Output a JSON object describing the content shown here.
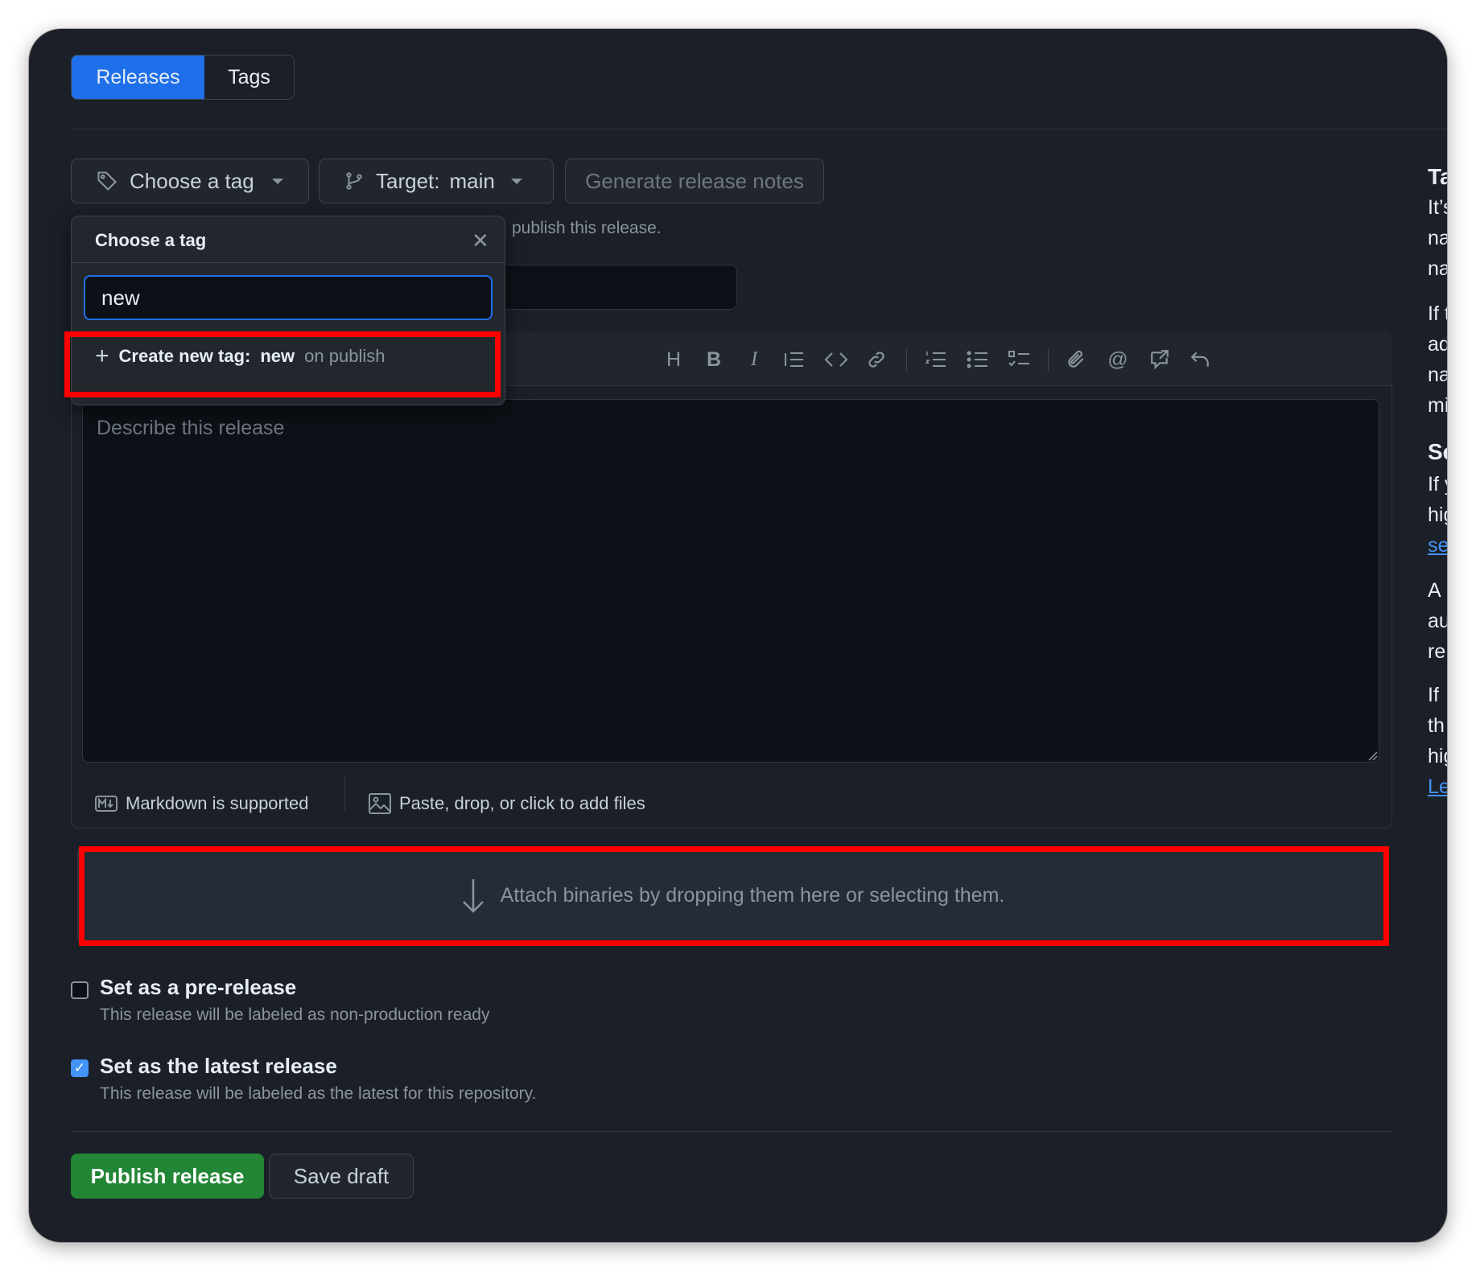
{
  "tabs": {
    "releases": "Releases",
    "tags": "Tags"
  },
  "tag_button": {
    "label": "Choose a tag"
  },
  "target_button": {
    "prefix": "Target:",
    "branch": "main"
  },
  "generate_notes": {
    "label": "Generate release notes"
  },
  "tag_hint": "publish this release.",
  "editor": {
    "toolbar_icons": [
      "heading-icon",
      "bold-icon",
      "italic-icon",
      "quote-icon",
      "code-icon",
      "link-icon",
      "numbered-list-icon",
      "bulleted-list-icon",
      "task-list-icon",
      "attach-icon",
      "mention-icon",
      "cross-reference-icon",
      "undo-icon"
    ],
    "placeholder": "Describe this release",
    "markdown_note": "Markdown is supported",
    "paste_note": "Paste, drop, or click to add files"
  },
  "attach": {
    "text": "Attach binaries by dropping them here or selecting them."
  },
  "options": {
    "prerelease": {
      "title": "Set as a pre-release",
      "desc": "This release will be labeled as non-production ready",
      "checked": false
    },
    "latest": {
      "title": "Set as the latest release",
      "desc": "This release will be labeled as the latest for this repository.",
      "checked": true
    }
  },
  "actions": {
    "publish": "Publish release",
    "save": "Save draft"
  },
  "sidebar_fragments": [
    "Ta",
    "It’s",
    "na",
    "na",
    "If t",
    "ad",
    "na",
    "mi",
    "Se",
    "If y",
    "hig",
    "se",
    "A",
    "au",
    "re",
    "If",
    "th",
    "hig",
    "Le"
  ],
  "popover": {
    "title": "Choose a tag",
    "input_value": "new",
    "create_prefix": "Create new tag:",
    "create_name": "new",
    "create_suffix": "on publish"
  },
  "colors": {
    "accent": "#1f6feb",
    "publish": "#238636",
    "highlight": "#ff0000",
    "background": "#1b1f27"
  }
}
